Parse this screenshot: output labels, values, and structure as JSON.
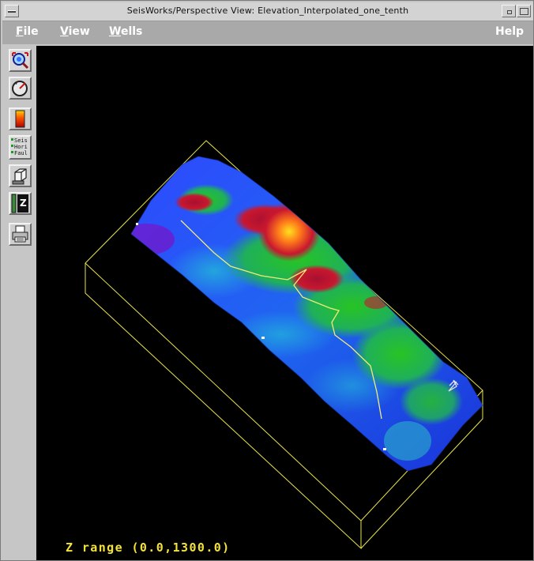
{
  "window": {
    "title": "SeisWorks/Perspective View: Elevation_Interpolated_one_tenth"
  },
  "menubar": {
    "file": {
      "mnemonic": "F",
      "rest": "ile"
    },
    "view": {
      "mnemonic": "V",
      "rest": "iew"
    },
    "wells": {
      "mnemonic": "W",
      "rest": "ells"
    },
    "help": "Help"
  },
  "toolbar": {
    "tools": [
      {
        "name": "zoom-tool-icon"
      },
      {
        "name": "rotate-tool-icon"
      },
      {
        "name": "color-scale-icon"
      },
      {
        "name": "display-toggles-icon",
        "labels": [
          "Seis",
          "Hori",
          "Faul"
        ]
      },
      {
        "name": "cube-view-icon"
      },
      {
        "name": "z-scale-icon",
        "label": "Z"
      },
      {
        "name": "print-icon"
      }
    ]
  },
  "viewport": {
    "z_range_text": "Z range (0.0,1300.0)",
    "colors": {
      "background": "#000000",
      "bounding_box": "#e8e44a",
      "fault_line": "#f0ec78"
    },
    "colormap": [
      "#6a1fd0",
      "#2a2af5",
      "#1f7bf0",
      "#22b7d8",
      "#1fb05a",
      "#27c424",
      "#b0d010",
      "#c8172f",
      "#ff7a1a",
      "#ffe11f"
    ]
  }
}
